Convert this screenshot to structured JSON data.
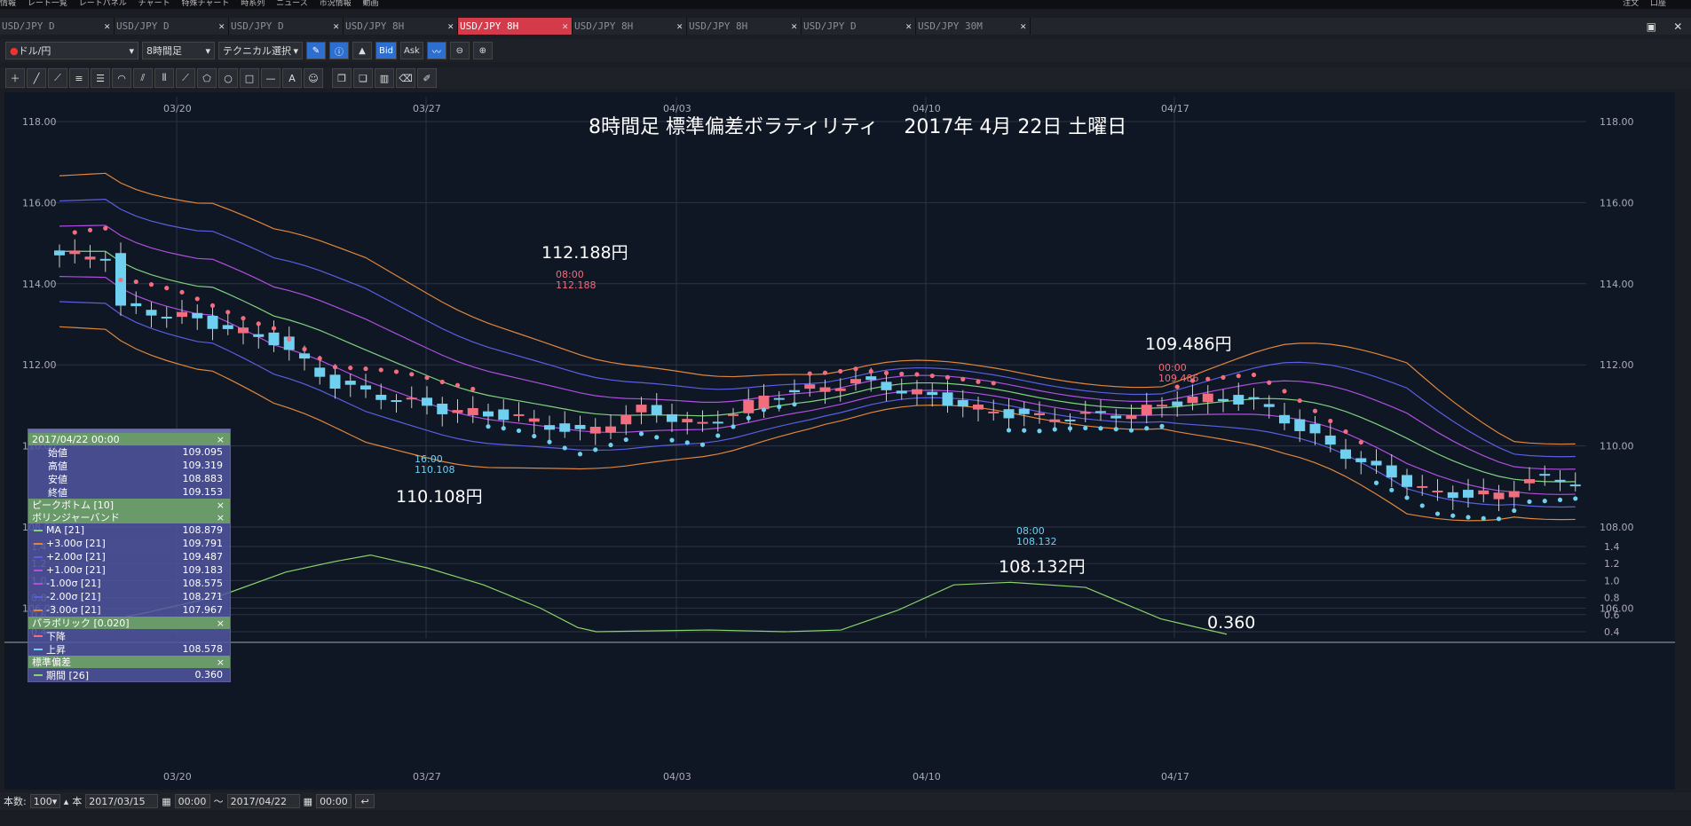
{
  "menubar": {
    "items": [
      "情報",
      "レート一覧",
      "レートパネル",
      "チャート",
      "特殊チャート",
      "時系列",
      "ニュース",
      "市況情報",
      "動画"
    ],
    "right": [
      "注文",
      "口座"
    ]
  },
  "tabs": [
    {
      "label": "USD/JPY D",
      "active": false
    },
    {
      "label": "USD/JPY D",
      "active": false
    },
    {
      "label": "USD/JPY D",
      "active": false
    },
    {
      "label": "USD/JPY 8H",
      "active": false
    },
    {
      "label": "USD/JPY 8H",
      "active": true
    },
    {
      "label": "USD/JPY 8H",
      "active": false
    },
    {
      "label": "USD/JPY 8H",
      "active": false
    },
    {
      "label": "USD/JPY D",
      "active": false
    },
    {
      "label": "USD/JPY 30M",
      "active": false
    }
  ],
  "toolbar": {
    "pair": "ドル/円",
    "period": "8時間足",
    "technical": "テクニカル選択",
    "bid": "Bid",
    "ask": "Ask"
  },
  "chart": {
    "title": "8時間足 標準偏差ボラティリティ　 2017年 4月 22日 土曜日",
    "x_dates": [
      "03/20",
      "03/27",
      "04/03",
      "04/10",
      "04/17"
    ],
    "y_ticks": [
      "118.00",
      "116.00",
      "114.00",
      "112.00",
      "110.00",
      "108.00",
      "106.00"
    ],
    "sub_ticks": [
      "1.4",
      "1.2",
      "1.0",
      "0.8",
      "0.6",
      "0.4"
    ],
    "annotations": {
      "high1": "112.188円",
      "high1_time": "08:00",
      "high1_val": "112.188",
      "low1": "110.108円",
      "low1_time": "16:00",
      "low1_val": "110.108",
      "low2": "108.132円",
      "low2_time": "08:00",
      "low2_val": "108.132",
      "high2": "109.486円",
      "high2_time": "00:00",
      "high2_val": "109.486",
      "stdev_last": "0.360"
    },
    "colors": {
      "bg": "#0f1624",
      "up": "#f26d7d",
      "down": "#6fd0f0",
      "ma": "#7fd37f",
      "sig3": "#e0873a",
      "sig2": "#5a5fe0",
      "sig1": "#b04fe0",
      "sar_up": "#6fd0f0",
      "sar_down": "#f26d7d",
      "stdev": "#8bd46b"
    }
  },
  "legend": {
    "date": "2017/04/22 00:00",
    "ohlc": [
      {
        "label": "始値",
        "value": "109.095"
      },
      {
        "label": "高値",
        "value": "109.319"
      },
      {
        "label": "安値",
        "value": "108.883"
      },
      {
        "label": "終値",
        "value": "109.153"
      }
    ],
    "peak": "ピークボトム [10]",
    "bb": "ボリンジャーバンド",
    "bb_rows": [
      {
        "label": "MA [21]",
        "value": "108.879",
        "color": "#7fd37f"
      },
      {
        "label": "+3.00σ [21]",
        "value": "109.791",
        "color": "#e0873a"
      },
      {
        "label": "+2.00σ [21]",
        "value": "109.487",
        "color": "#5a5fe0"
      },
      {
        "label": "+1.00σ [21]",
        "value": "109.183",
        "color": "#b04fe0"
      },
      {
        "label": "-1.00σ [21]",
        "value": "108.575",
        "color": "#b04fe0"
      },
      {
        "label": "-2.00σ [21]",
        "value": "108.271",
        "color": "#5a5fe0"
      },
      {
        "label": "-3.00σ [21]",
        "value": "107.967",
        "color": "#e0873a"
      }
    ],
    "sar": "パラボリック [0.020]",
    "sar_rows": [
      {
        "label": "下降",
        "value": "",
        "color": "#f26d7d"
      },
      {
        "label": "上昇",
        "value": "108.578",
        "color": "#6fd0f0"
      }
    ],
    "sd": "標準偏差",
    "sd_rows": [
      {
        "label": "期間 [26]",
        "value": "0.360",
        "color": "#8bd46b"
      }
    ],
    "close": "×"
  },
  "bottom": {
    "count_label": "本数:",
    "count": "100",
    "unit": "本",
    "from_date": "2017/03/15",
    "from_time": "00:00",
    "tilde": "～",
    "to_date": "2017/04/22",
    "to_time": "00:00"
  }
}
